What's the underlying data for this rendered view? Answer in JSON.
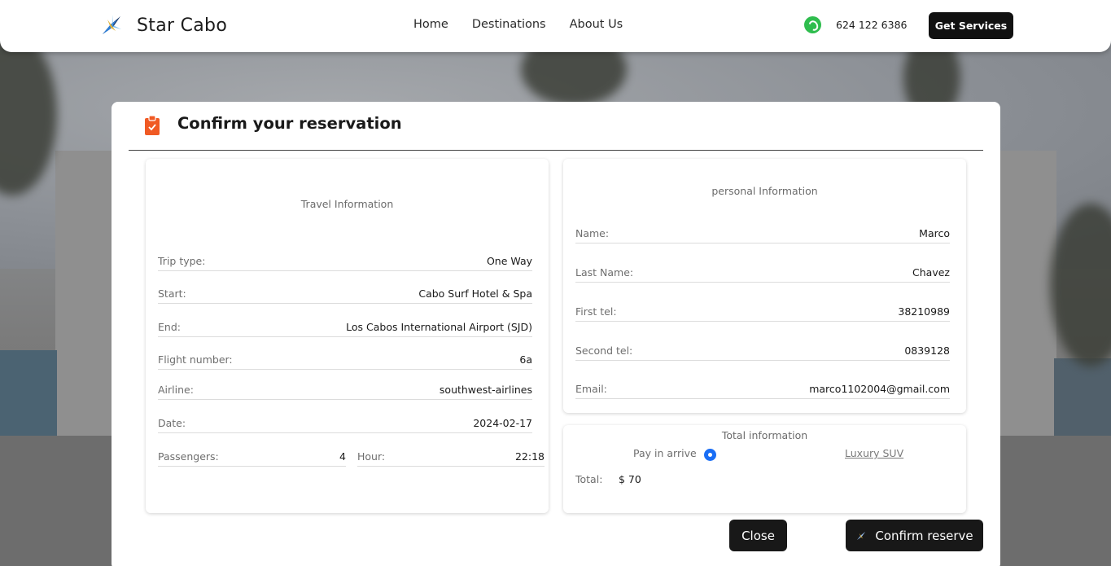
{
  "navbar": {
    "brand": "Star Cabo",
    "logo_icon": "star-logo-icon",
    "links": [
      "Home",
      "Destinations",
      "About Us"
    ],
    "phone_icon": "whatsapp-icon",
    "phone": "624 122 6386",
    "cta": "Get Services"
  },
  "modal": {
    "icon": "clipboard-check-icon",
    "title": "Confirm your reservation",
    "travel": {
      "heading": "Travel Information",
      "fields": [
        {
          "label": "Trip type:",
          "value": "One Way"
        },
        {
          "label": "Start:",
          "value": "Cabo Surf Hotel & Spa"
        },
        {
          "label": "End:",
          "value": "Los Cabos International Airport (SJD)"
        },
        {
          "label": "Flight number:",
          "value": "6a"
        },
        {
          "label": "Airline:",
          "value": "southwest-airlines"
        },
        {
          "label": "Date:",
          "value": "2024-02-17"
        }
      ],
      "passengers": {
        "label": "Passengers:",
        "value": "4"
      },
      "hour": {
        "label": "Hour:",
        "value": "22:18"
      }
    },
    "personal": {
      "heading": "personal Information",
      "fields": [
        {
          "label": "Name:",
          "value": "Marco"
        },
        {
          "label": "Last Name:",
          "value": "Chavez"
        },
        {
          "label": "First tel:",
          "value": "38210989"
        },
        {
          "label": "Second tel:",
          "value": "0839128"
        },
        {
          "label": "Email:",
          "value": "marco1102004@gmail.com"
        }
      ]
    },
    "total": {
      "heading": "Total information",
      "pay_option": "Pay in arrive",
      "pay_selected": true,
      "vehicle": "Luxury SUV",
      "total_label": "Total:",
      "total_value": "$ 70"
    },
    "buttons": {
      "close": "Close",
      "confirm": "Confirm reserve"
    }
  },
  "colors": {
    "accent": "#1a6ef5",
    "button": "#181818",
    "clipboard": "#f05a24",
    "whatsapp": "#2fbd4e"
  }
}
